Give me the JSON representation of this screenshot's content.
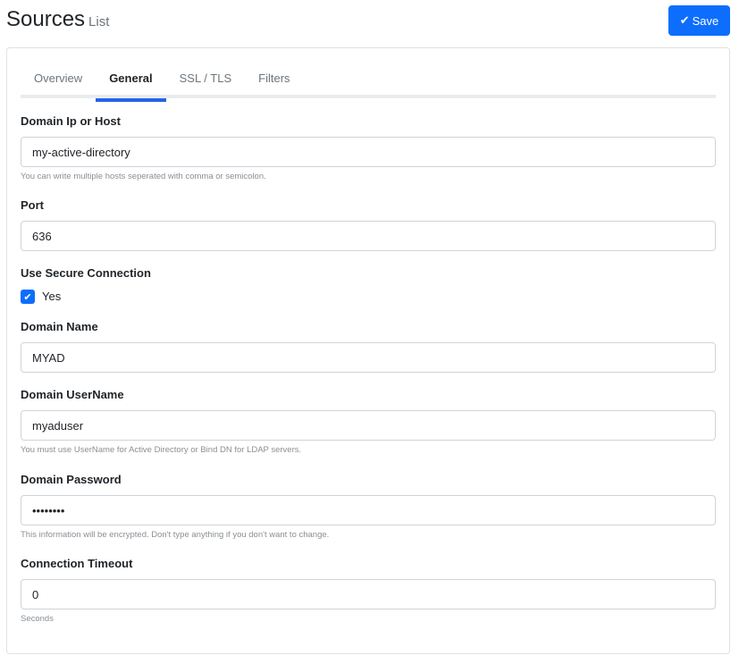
{
  "header": {
    "title": "Sources",
    "subtitle": "List",
    "save_label": "Save"
  },
  "tabs": [
    {
      "label": "Overview"
    },
    {
      "label": "General"
    },
    {
      "label": "SSL / TLS"
    },
    {
      "label": "Filters"
    }
  ],
  "form": {
    "host": {
      "label": "Domain Ip or Host",
      "value": "my-active-directory",
      "help": "You can write multiple hosts seperated with comma or semicolon."
    },
    "port": {
      "label": "Port",
      "value": "636"
    },
    "secure": {
      "label": "Use Secure Connection",
      "option": "Yes",
      "checked": true
    },
    "domain_name": {
      "label": "Domain Name",
      "value": "MYAD"
    },
    "username": {
      "label": "Domain UserName",
      "value": "myaduser",
      "help": "You must use UserName for Active Directory or Bind DN for LDAP servers."
    },
    "password": {
      "label": "Domain Password",
      "value": "secret12",
      "help": "This information will be encrypted. Don't type anything if you don't want to change."
    },
    "timeout": {
      "label": "Connection Timeout",
      "value": "0",
      "help": "Seconds"
    }
  },
  "colors": {
    "accent": "#0d6efd"
  }
}
